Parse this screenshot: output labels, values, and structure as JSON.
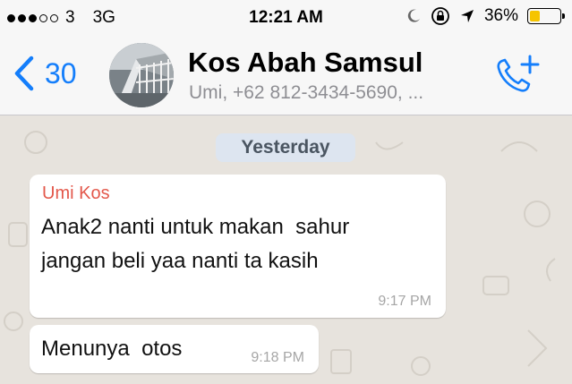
{
  "status": {
    "carrier": "3",
    "network": "3G",
    "time": "12:21 AM",
    "battery": "36%",
    "battery_level": 0.36,
    "battery_color": "#f5c400"
  },
  "header": {
    "back_count": "30",
    "title": "Kos Abah Samsul",
    "subtitle": "Umi, +62 812-3434-5690, ...",
    "accent": "#147efb"
  },
  "chat": {
    "date_label": "Yesterday",
    "messages": [
      {
        "sender": "Umi Kos",
        "line1": "Anak2 nanti untuk makan  sahur",
        "line2": "jangan beli yaa nanti ta kasih",
        "time": "9:17 PM"
      },
      {
        "text": "Menunya  otos",
        "time": "9:18 PM"
      }
    ]
  },
  "icons": [
    "signal-dots",
    "moon-icon",
    "lock-rotation-icon",
    "location-arrow-icon",
    "battery-icon",
    "chevron-left-icon",
    "add-call-icon"
  ]
}
